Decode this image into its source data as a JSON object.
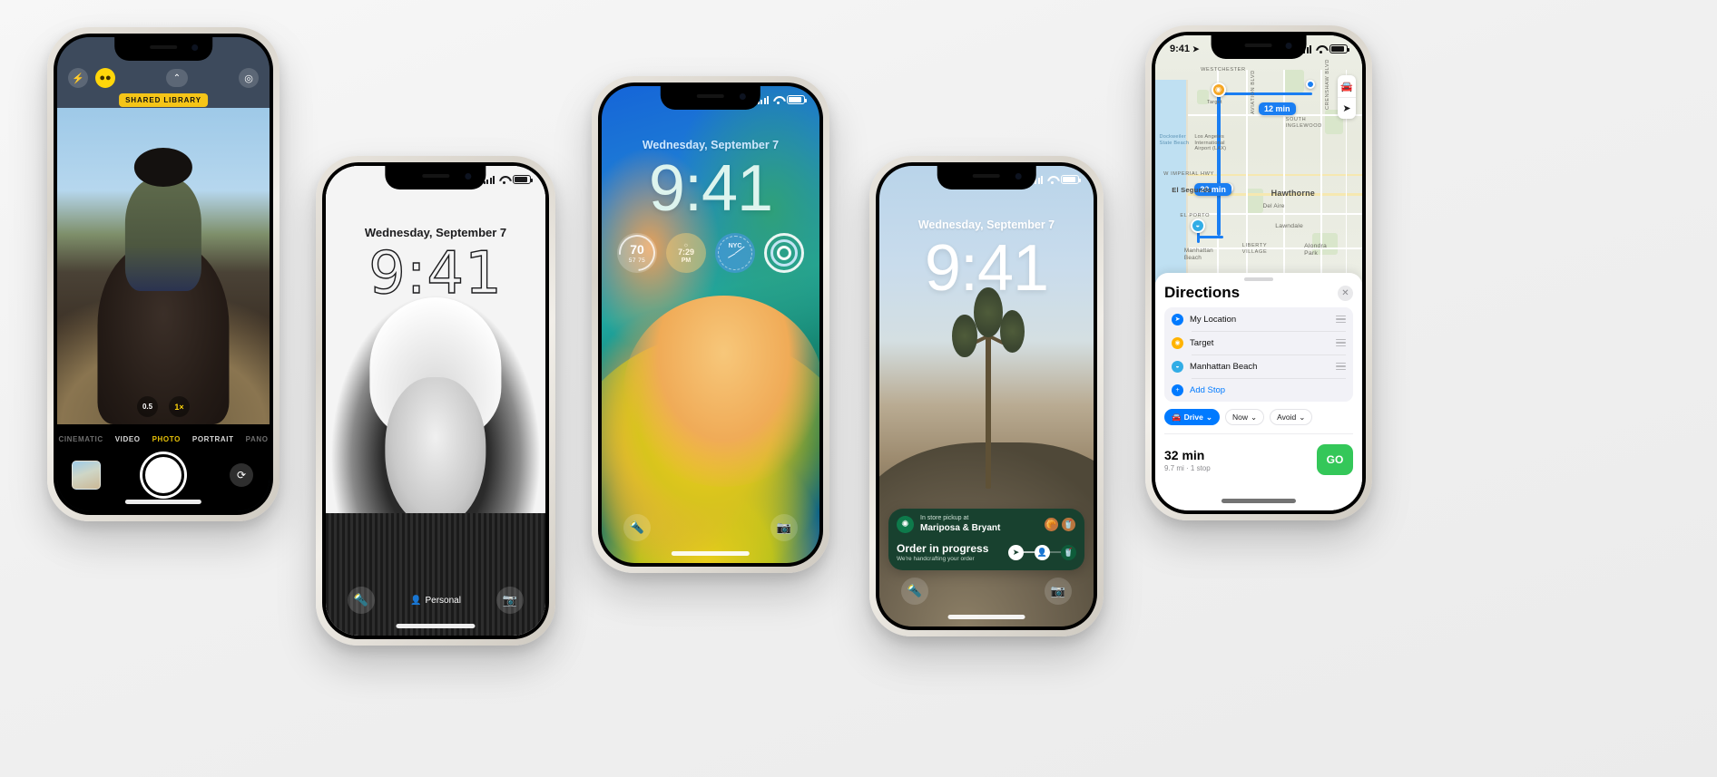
{
  "scene": {
    "title": "iPhone lineup showcase",
    "background_color": "#f2f2f2"
  },
  "phone_camera": {
    "name": "Camera app",
    "shared_library_badge": "SHARED LIBRARY",
    "icons": {
      "flash": "⚡",
      "shared_library": "●●",
      "chevron_up": "⌃",
      "live_photo": "◎"
    },
    "zoom_options": [
      {
        "label": "0.5",
        "active": false
      },
      {
        "label": "1×",
        "active": true
      }
    ],
    "modes": [
      {
        "label": "CINEMATIC",
        "active": false,
        "edge": true
      },
      {
        "label": "VIDEO",
        "active": false,
        "edge": false
      },
      {
        "label": "PHOTO",
        "active": true,
        "edge": false
      },
      {
        "label": "PORTRAIT",
        "active": false,
        "edge": false
      },
      {
        "label": "PANO",
        "active": false,
        "edge": true
      }
    ],
    "shutter_label": "",
    "flip_icon": "⟳"
  },
  "phone_lock_bw": {
    "name": "Lock Screen (black and white portrait)",
    "date": "Wednesday, September 7",
    "time": "9:41",
    "focus_label": "Personal",
    "flashlight_icon": "🔦",
    "camera_icon": "📷",
    "person_icon": "👤"
  },
  "phone_lock_color": {
    "name": "Lock Screen (colorful wallpaper with widgets)",
    "date": "Wednesday, September 7",
    "time": "9:41",
    "widgets": [
      {
        "kind": "weather",
        "value": "70",
        "range": "57  75"
      },
      {
        "kind": "sunset",
        "time": "7:29",
        "meridiem": "PM",
        "icon": "☼"
      },
      {
        "kind": "world-clock",
        "city": "NYC"
      },
      {
        "kind": "fitness-rings",
        "label": ""
      }
    ],
    "flashlight_icon": "🔦",
    "camera_icon": "📷"
  },
  "phone_lock_liveactivity": {
    "name": "Lock Screen with Live Activity",
    "date": "Wednesday, September 7",
    "time": "9:41",
    "live_activity": {
      "app": "Starbucks",
      "pickup_label": "In store pickup at",
      "store_name": "Mariposa & Bryant",
      "status_title": "Order in progress",
      "status_subtitle": "We're handcrafting your order",
      "items": [
        "🥐",
        "🥤"
      ],
      "progress_nodes": [
        "➤",
        "👤",
        "🥤"
      ]
    },
    "flashlight_icon": "🔦",
    "camera_icon": "📷"
  },
  "phone_maps": {
    "name": "Maps with Directions sheet",
    "status_time": "9:41",
    "location_arrow": "➤",
    "map": {
      "eta_badges": [
        {
          "label": "12 min"
        },
        {
          "label": "20 min"
        }
      ],
      "labels": [
        "WESTCHESTER",
        "Target",
        "SOUTH INGLEWOOD",
        "Dockweiler State Beach",
        "Los Angeles International Airport (LAX)",
        "W IMPERIAL HWY",
        "AVIATION BLVD",
        "El Segundo",
        "Hawthorne",
        "Del Aire",
        "Lawndale",
        "Alondra Park",
        "EL PORTO",
        "LIBERTY VILLAGE",
        "Manhattan Beach",
        "CRENSHAW BLVD"
      ],
      "controls": {
        "car_icon": "🚘",
        "locate_icon": "➤"
      }
    },
    "sheet": {
      "title": "Directions",
      "close_icon": "✕",
      "stops": [
        {
          "label": "My Location",
          "dot": "blue",
          "glyph": "➤",
          "link": false
        },
        {
          "label": "Target",
          "dot": "orange",
          "glyph": "◉",
          "link": false
        },
        {
          "label": "Manhattan Beach",
          "dot": "cyan",
          "glyph": "◒",
          "link": false
        },
        {
          "label": "Add Stop",
          "dot": "add",
          "glyph": "+",
          "link": true
        }
      ],
      "chips": [
        {
          "label": "Drive",
          "icon": "🚘",
          "caret": "⌄",
          "primary": true
        },
        {
          "label": "Now",
          "icon": "",
          "caret": "⌄",
          "primary": false
        },
        {
          "label": "Avoid",
          "icon": "",
          "caret": "⌄",
          "primary": false
        }
      ],
      "route": {
        "duration": "32 min",
        "detail": "9.7 mi · 1 stop",
        "go_label": "GO"
      }
    }
  }
}
